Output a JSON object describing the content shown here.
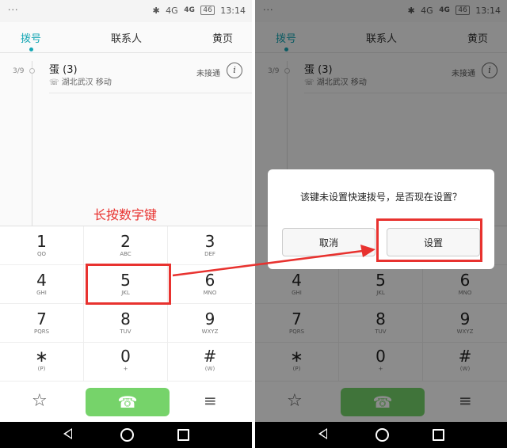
{
  "status_bar": {
    "dots": "···",
    "bluetooth": "✱",
    "network": "4G",
    "signal_small": "4G",
    "battery": "46",
    "time": "13:14"
  },
  "tabs": {
    "dial": "拨号",
    "contacts": "联系人",
    "yellow_pages": "黄页"
  },
  "call_log": {
    "date": "3/9",
    "name": "蛋 (3)",
    "location": "湖北武汉 移动",
    "status": "未接通",
    "info_icon": "i"
  },
  "keypad": [
    {
      "digit": "1",
      "letters": "QO"
    },
    {
      "digit": "2",
      "letters": "ABC"
    },
    {
      "digit": "3",
      "letters": "DEF"
    },
    {
      "digit": "4",
      "letters": "GHI"
    },
    {
      "digit": "5",
      "letters": "JKL"
    },
    {
      "digit": "6",
      "letters": "MNO"
    },
    {
      "digit": "7",
      "letters": "PQRS"
    },
    {
      "digit": "8",
      "letters": "TUV"
    },
    {
      "digit": "9",
      "letters": "WXYZ"
    },
    {
      "digit": "∗",
      "letters": "(P)"
    },
    {
      "digit": "0",
      "letters": "+"
    },
    {
      "digit": "#",
      "letters": "(W)"
    }
  ],
  "actions": {
    "star": "☆",
    "call": "☎",
    "menu": "≡"
  },
  "annotation": "长按数字键",
  "dialog": {
    "message": "该键未设置快速拨号，是否现在设置？",
    "cancel": "取消",
    "confirm": "设置"
  },
  "colors": {
    "accent": "#17a7b5",
    "call_green": "#76d36a",
    "annotation_red": "#e8322f"
  }
}
